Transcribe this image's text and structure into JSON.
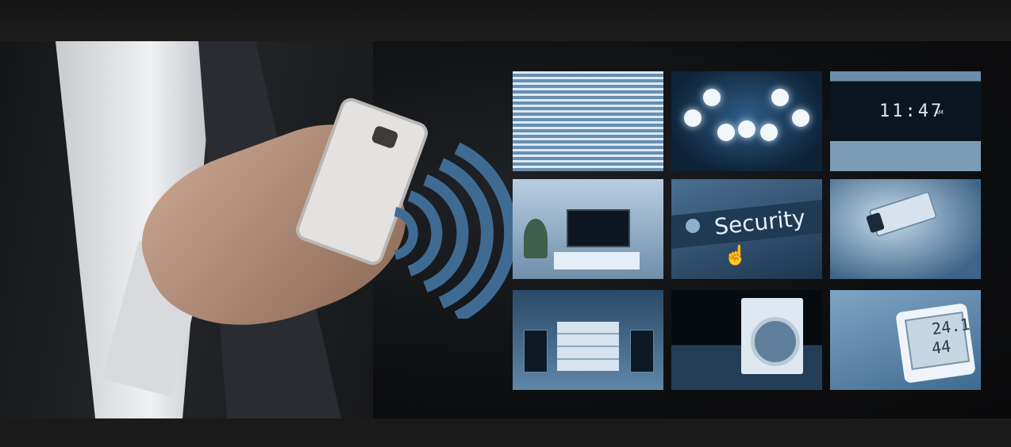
{
  "scene": {
    "subject": "person-holding-smartphone",
    "signal_icon": "wifi-signal-icon",
    "colors": {
      "accent": "#4f7ea6",
      "background": "#0d0e10"
    }
  },
  "tiles": [
    {
      "name": "window-blinds-tile"
    },
    {
      "name": "ceiling-lamp-tile"
    },
    {
      "name": "alarm-clock-tile",
      "clock_time": "11:47",
      "clock_ampm": "AM"
    },
    {
      "name": "living-room-tv-tile"
    },
    {
      "name": "security-button-tile",
      "label": "Security"
    },
    {
      "name": "security-camera-tile"
    },
    {
      "name": "stereo-system-tile"
    },
    {
      "name": "washing-machine-tile"
    },
    {
      "name": "thermometer-tile",
      "temperature": "24.1",
      "humidity": "44"
    }
  ]
}
